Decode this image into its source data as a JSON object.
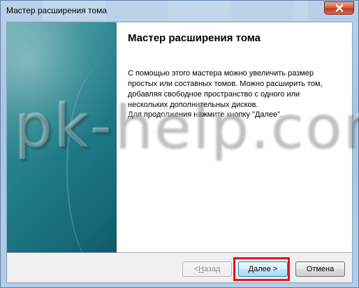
{
  "window": {
    "title": "Мастер расширения тома"
  },
  "wizard": {
    "heading": "Мастер расширения тома",
    "paragraph1": "С помощью этого мастера можно увеличить размер простых или составных томов. Можно расширить том, добавляя свободное пространство с одного или нескольких дополнительных дисков.",
    "paragraph2": "Для продолжения нажмите кнопку \"Далее\"."
  },
  "buttons": {
    "back_prefix": "< ",
    "back_mnemonic": "Н",
    "back_rest": "азад",
    "next": "Далее >",
    "cancel": "Отмена"
  },
  "watermark": "pk-help.com",
  "colors": {
    "highlight": "#e0141e",
    "sidebar": "#1f7a86",
    "close_button": "#c0391f"
  },
  "icons": {
    "close": "close-x-icon"
  }
}
